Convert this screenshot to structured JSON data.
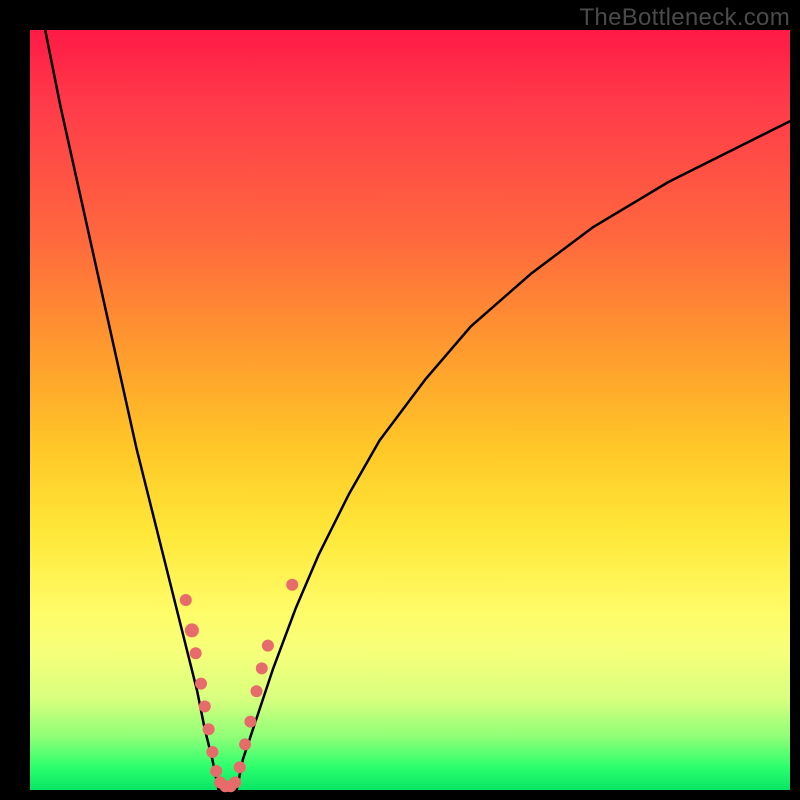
{
  "watermark": "TheBottleneck.com",
  "chart_data": {
    "type": "line",
    "title": "",
    "xlabel": "",
    "ylabel": "",
    "xlim": [
      0,
      100
    ],
    "ylim": [
      0,
      100
    ],
    "grid": false,
    "legend": false,
    "series": [
      {
        "name": "curve-left",
        "x": [
          2,
          4,
          6,
          8,
          10,
          12,
          14,
          16,
          18,
          20,
          22,
          23,
          24,
          24.8
        ],
        "y": [
          100,
          90,
          81,
          72,
          63,
          54,
          45,
          37,
          29,
          21,
          13,
          8,
          4,
          0
        ]
      },
      {
        "name": "curve-right",
        "x": [
          27.2,
          28,
          30,
          32,
          35,
          38,
          42,
          46,
          52,
          58,
          66,
          74,
          84,
          94,
          100
        ],
        "y": [
          0,
          4,
          10,
          16,
          24,
          31,
          39,
          46,
          54,
          61,
          68,
          74,
          80,
          85,
          88
        ]
      },
      {
        "name": "trough-floor",
        "x": [
          24.8,
          25.5,
          26,
          26.5,
          27.2
        ],
        "y": [
          0,
          0,
          0,
          0,
          0
        ]
      }
    ],
    "markers": [
      {
        "x": 20.5,
        "y": 25,
        "r": 6
      },
      {
        "x": 21.3,
        "y": 21,
        "r": 7
      },
      {
        "x": 21.8,
        "y": 18,
        "r": 6
      },
      {
        "x": 22.5,
        "y": 14,
        "r": 6
      },
      {
        "x": 23.0,
        "y": 11,
        "r": 6
      },
      {
        "x": 23.5,
        "y": 8,
        "r": 6
      },
      {
        "x": 24.0,
        "y": 5,
        "r": 6
      },
      {
        "x": 24.5,
        "y": 2.5,
        "r": 6
      },
      {
        "x": 25.0,
        "y": 1,
        "r": 6
      },
      {
        "x": 25.7,
        "y": 0.5,
        "r": 6
      },
      {
        "x": 26.4,
        "y": 0.5,
        "r": 6
      },
      {
        "x": 27.0,
        "y": 1,
        "r": 6
      },
      {
        "x": 27.6,
        "y": 3,
        "r": 6
      },
      {
        "x": 28.3,
        "y": 6,
        "r": 6
      },
      {
        "x": 29.0,
        "y": 9,
        "r": 6
      },
      {
        "x": 29.8,
        "y": 13,
        "r": 6
      },
      {
        "x": 30.5,
        "y": 16,
        "r": 6
      },
      {
        "x": 31.3,
        "y": 19,
        "r": 6
      },
      {
        "x": 34.5,
        "y": 27,
        "r": 6
      }
    ],
    "colors": {
      "curve": "#000000",
      "marker_fill": "#e76b6b",
      "marker_stroke": "#e76b6b",
      "gradient_top": "#ff1a45",
      "gradient_bottom": "#08e565",
      "frame": "#000000"
    }
  }
}
